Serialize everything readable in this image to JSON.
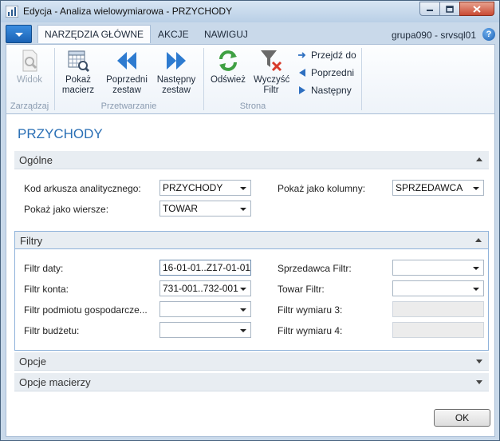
{
  "window": {
    "title": "Edycja - Analiza wielowymiarowa - PRZYCHODY"
  },
  "ribbon": {
    "tabs": [
      {
        "label": "NARZĘDZIA GŁÓWNE",
        "active": true
      },
      {
        "label": "AKCJE",
        "active": false
      },
      {
        "label": "NAWIGUJ",
        "active": false
      }
    ],
    "company": "grupa090 - srvsql01",
    "help": "?",
    "groups": {
      "manage": {
        "label": "Zarządzaj",
        "view_label": "Widok"
      },
      "process": {
        "label": "Przetwarzanie",
        "show_matrix": "Pokaż macierz",
        "prev_set": "Poprzedni zestaw",
        "next_set": "Następny zestaw"
      },
      "page": {
        "label": "Strona",
        "refresh": "Odśwież",
        "clear_filter": "Wyczyść Filtr",
        "goto": "Przejdź do",
        "previous": "Poprzedni",
        "next": "Następny"
      }
    }
  },
  "page": {
    "title": "PRZYCHODY"
  },
  "general": {
    "header": "Ogólne",
    "analysis_view_code_label": "Kod arkusza analitycznego:",
    "analysis_view_code_value": "PRZYCHODY",
    "show_as_columns_label": "Pokaż jako kolumny:",
    "show_as_columns_value": "SPRZEDAWCA",
    "show_as_rows_label": "Pokaż jako wiersze:",
    "show_as_rows_value": "TOWAR"
  },
  "filters": {
    "header": "Filtry",
    "date_filter_label": "Filtr daty:",
    "date_filter_value": "16-01-01..Z17-01-01",
    "account_filter_label": "Filtr konta:",
    "account_filter_value": "731-001..732-001",
    "business_unit_filter_label": "Filtr podmiotu gospodarcze...",
    "business_unit_filter_value": "",
    "budget_filter_label": "Filtr budżetu:",
    "budget_filter_value": "",
    "salesperson_filter_label": "Sprzedawca Filtr:",
    "salesperson_filter_value": "",
    "item_filter_label": "Towar Filtr:",
    "item_filter_value": "",
    "dim3_filter_label": "Filtr wymiaru 3:",
    "dim3_filter_value": "",
    "dim4_filter_label": "Filtr wymiaru 4:",
    "dim4_filter_value": ""
  },
  "options": {
    "header": "Opcje"
  },
  "matrix_options": {
    "header": "Opcje macierzy"
  },
  "footer": {
    "ok_label": "OK"
  }
}
